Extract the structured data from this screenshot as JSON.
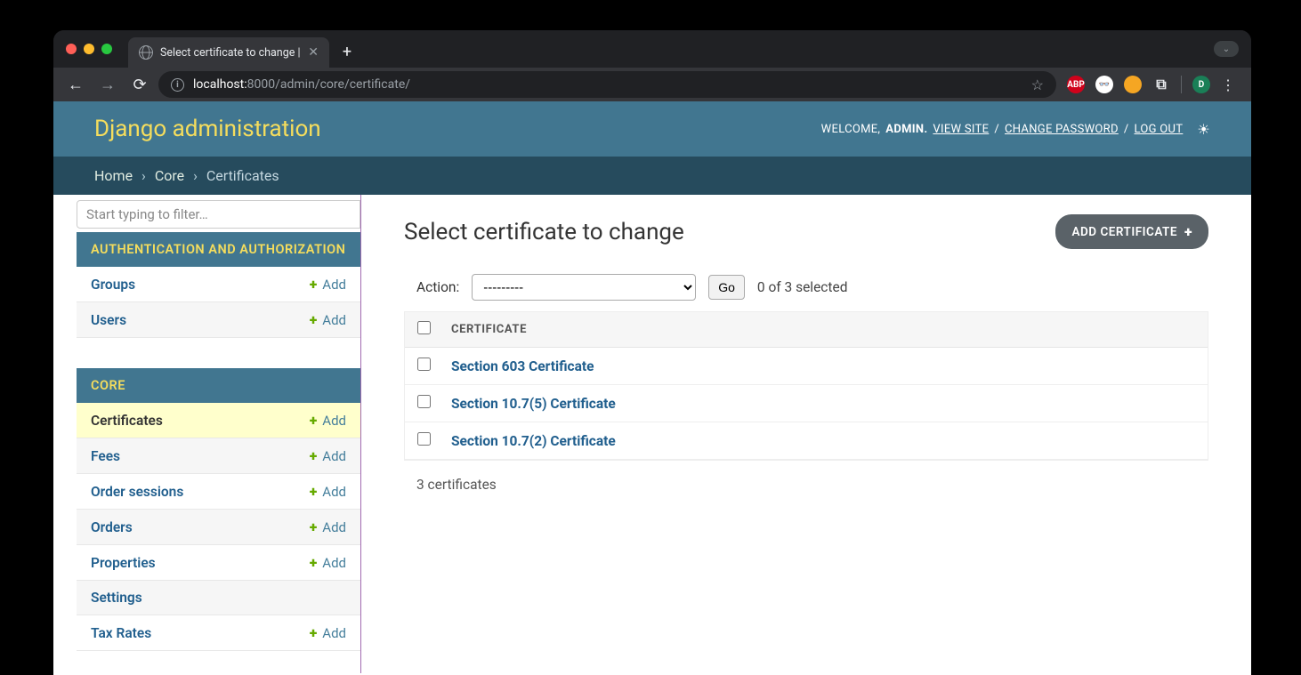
{
  "browser": {
    "tab_title": "Select certificate to change |",
    "url_prefix": "localhost:",
    "url_rest": "8000/admin/core/certificate/",
    "profile_letter": "D"
  },
  "header": {
    "site_title": "Django administration",
    "welcome": "WELCOME,",
    "user": "ADMIN",
    "view_site": "VIEW SITE",
    "change_password": "CHANGE PASSWORD",
    "log_out": "LOG OUT"
  },
  "breadcrumb": {
    "home": "Home",
    "app": "Core",
    "model": "Certificates"
  },
  "sidebar": {
    "filter_placeholder": "Start typing to filter…",
    "apps": [
      {
        "label": "AUTHENTICATION AND AUTHORIZATION",
        "models": [
          {
            "name": "Groups",
            "add": "Add"
          },
          {
            "name": "Users",
            "add": "Add"
          }
        ]
      },
      {
        "label": "CORE",
        "models": [
          {
            "name": "Certificates",
            "add": "Add",
            "active": true
          },
          {
            "name": "Fees",
            "add": "Add"
          },
          {
            "name": "Order sessions",
            "add": "Add"
          },
          {
            "name": "Orders",
            "add": "Add"
          },
          {
            "name": "Properties",
            "add": "Add"
          },
          {
            "name": "Settings"
          },
          {
            "name": "Tax Rates",
            "add": "Add"
          }
        ]
      }
    ]
  },
  "main": {
    "title": "Select certificate to change",
    "add_button": "ADD CERTIFICATE",
    "action_label": "Action:",
    "action_placeholder": "---------",
    "go": "Go",
    "selection_count": "0 of 3 selected",
    "column_header": "CERTIFICATE",
    "rows": [
      {
        "name": "Section 603 Certificate"
      },
      {
        "name": "Section 10.7(5) Certificate"
      },
      {
        "name": "Section 10.7(2) Certificate"
      }
    ],
    "count_text": "3 certificates"
  }
}
